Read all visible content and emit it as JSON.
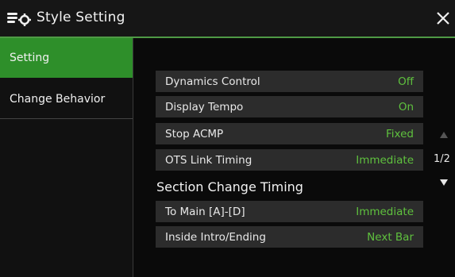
{
  "header": {
    "title": "Style Setting",
    "icon": "style-setting-icon",
    "close_icon": "close-icon"
  },
  "sidebar": {
    "tabs": [
      {
        "label": "Setting",
        "active": true
      },
      {
        "label": "Change Behavior",
        "active": false
      }
    ]
  },
  "settings": {
    "rows": [
      {
        "label": "Dynamics Control",
        "value": "Off"
      },
      {
        "label": "Display Tempo",
        "value": "On"
      },
      {
        "label": "Stop ACMP",
        "value": "Fixed"
      },
      {
        "label": "OTS Link Timing",
        "value": "Immediate"
      }
    ],
    "section_title": "Section Change Timing",
    "section_rows": [
      {
        "label": "To Main [A]-[D]",
        "value": "Immediate"
      },
      {
        "label": "Inside Intro/Ending",
        "value": "Next Bar"
      }
    ]
  },
  "pager": {
    "page": "1/2",
    "up_icon": "triangle-up-icon",
    "down_icon": "triangle-down-icon",
    "up_enabled": false,
    "down_enabled": true
  },
  "colors": {
    "accent": "#2e8f2a",
    "value": "#5fc13e",
    "row_bg": "#2c2c2c",
    "background": "#0a0a0a"
  }
}
